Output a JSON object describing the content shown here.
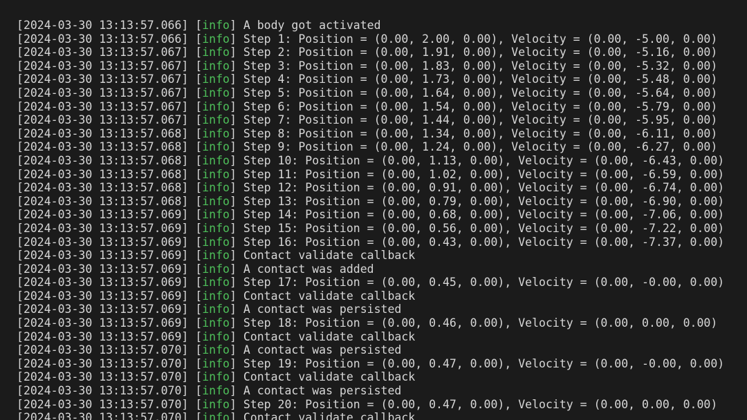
{
  "colors": {
    "background": "#1b1b1b",
    "text": "#d7d7d7",
    "info": "#4ec05a"
  },
  "log": [
    {
      "ts": "2024-03-30 13:13:57.066",
      "level": "info",
      "msg": "A body got activated"
    },
    {
      "ts": "2024-03-30 13:13:57.066",
      "level": "info",
      "msg": "Step 1: Position = (0.00, 2.00, 0.00), Velocity = (0.00, -5.00, 0.00)"
    },
    {
      "ts": "2024-03-30 13:13:57.067",
      "level": "info",
      "msg": "Step 2: Position = (0.00, 1.91, 0.00), Velocity = (0.00, -5.16, 0.00)"
    },
    {
      "ts": "2024-03-30 13:13:57.067",
      "level": "info",
      "msg": "Step 3: Position = (0.00, 1.83, 0.00), Velocity = (0.00, -5.32, 0.00)"
    },
    {
      "ts": "2024-03-30 13:13:57.067",
      "level": "info",
      "msg": "Step 4: Position = (0.00, 1.73, 0.00), Velocity = (0.00, -5.48, 0.00)"
    },
    {
      "ts": "2024-03-30 13:13:57.067",
      "level": "info",
      "msg": "Step 5: Position = (0.00, 1.64, 0.00), Velocity = (0.00, -5.64, 0.00)"
    },
    {
      "ts": "2024-03-30 13:13:57.067",
      "level": "info",
      "msg": "Step 6: Position = (0.00, 1.54, 0.00), Velocity = (0.00, -5.79, 0.00)"
    },
    {
      "ts": "2024-03-30 13:13:57.067",
      "level": "info",
      "msg": "Step 7: Position = (0.00, 1.44, 0.00), Velocity = (0.00, -5.95, 0.00)"
    },
    {
      "ts": "2024-03-30 13:13:57.068",
      "level": "info",
      "msg": "Step 8: Position = (0.00, 1.34, 0.00), Velocity = (0.00, -6.11, 0.00)"
    },
    {
      "ts": "2024-03-30 13:13:57.068",
      "level": "info",
      "msg": "Step 9: Position = (0.00, 1.24, 0.00), Velocity = (0.00, -6.27, 0.00)"
    },
    {
      "ts": "2024-03-30 13:13:57.068",
      "level": "info",
      "msg": "Step 10: Position = (0.00, 1.13, 0.00), Velocity = (0.00, -6.43, 0.00)"
    },
    {
      "ts": "2024-03-30 13:13:57.068",
      "level": "info",
      "msg": "Step 11: Position = (0.00, 1.02, 0.00), Velocity = (0.00, -6.59, 0.00)"
    },
    {
      "ts": "2024-03-30 13:13:57.068",
      "level": "info",
      "msg": "Step 12: Position = (0.00, 0.91, 0.00), Velocity = (0.00, -6.74, 0.00)"
    },
    {
      "ts": "2024-03-30 13:13:57.068",
      "level": "info",
      "msg": "Step 13: Position = (0.00, 0.79, 0.00), Velocity = (0.00, -6.90, 0.00)"
    },
    {
      "ts": "2024-03-30 13:13:57.069",
      "level": "info",
      "msg": "Step 14: Position = (0.00, 0.68, 0.00), Velocity = (0.00, -7.06, 0.00)"
    },
    {
      "ts": "2024-03-30 13:13:57.069",
      "level": "info",
      "msg": "Step 15: Position = (0.00, 0.56, 0.00), Velocity = (0.00, -7.22, 0.00)"
    },
    {
      "ts": "2024-03-30 13:13:57.069",
      "level": "info",
      "msg": "Step 16: Position = (0.00, 0.43, 0.00), Velocity = (0.00, -7.37, 0.00)"
    },
    {
      "ts": "2024-03-30 13:13:57.069",
      "level": "info",
      "msg": "Contact validate callback"
    },
    {
      "ts": "2024-03-30 13:13:57.069",
      "level": "info",
      "msg": "A contact was added"
    },
    {
      "ts": "2024-03-30 13:13:57.069",
      "level": "info",
      "msg": "Step 17: Position = (0.00, 0.45, 0.00), Velocity = (0.00, -0.00, 0.00)"
    },
    {
      "ts": "2024-03-30 13:13:57.069",
      "level": "info",
      "msg": "Contact validate callback"
    },
    {
      "ts": "2024-03-30 13:13:57.069",
      "level": "info",
      "msg": "A contact was persisted"
    },
    {
      "ts": "2024-03-30 13:13:57.069",
      "level": "info",
      "msg": "Step 18: Position = (0.00, 0.46, 0.00), Velocity = (0.00, 0.00, 0.00)"
    },
    {
      "ts": "2024-03-30 13:13:57.069",
      "level": "info",
      "msg": "Contact validate callback"
    },
    {
      "ts": "2024-03-30 13:13:57.070",
      "level": "info",
      "msg": "A contact was persisted"
    },
    {
      "ts": "2024-03-30 13:13:57.070",
      "level": "info",
      "msg": "Step 19: Position = (0.00, 0.47, 0.00), Velocity = (0.00, -0.00, 0.00)"
    },
    {
      "ts": "2024-03-30 13:13:57.070",
      "level": "info",
      "msg": "Contact validate callback"
    },
    {
      "ts": "2024-03-30 13:13:57.070",
      "level": "info",
      "msg": "A contact was persisted"
    },
    {
      "ts": "2024-03-30 13:13:57.070",
      "level": "info",
      "msg": "Step 20: Position = (0.00, 0.47, 0.00), Velocity = (0.00, 0.00, 0.00)"
    },
    {
      "ts": "2024-03-30 13:13:57.070",
      "level": "info",
      "msg": "Contact validate callback"
    }
  ]
}
